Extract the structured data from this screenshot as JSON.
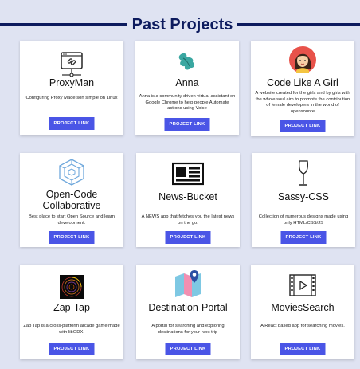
{
  "header": {
    "title": "Past Projects"
  },
  "projects": [
    {
      "name": "ProxyMan",
      "desc": "Configuring Proxy Made son simple on Linux",
      "button": "PROJECT LINK",
      "icon": "network-link-icon"
    },
    {
      "name": "Anna",
      "desc": "Anna is a community driven virtual assistant on Google Chrome to help people Automate actions using Voice",
      "button": "PROJECT LINK",
      "icon": "leaf-logo-icon"
    },
    {
      "name": "Code Like A Girl",
      "desc": "A website created for the girls and by girls with the whole soul aim to promote the contribution of female developers in the world of opensource",
      "button": "PROJECT LINK",
      "icon": "girl-avatar-icon"
    },
    {
      "name": "Open-Code Collaborative",
      "desc": "Best place to start Open Source and learn development.",
      "button": "PROJECT LINK",
      "icon": "cube-logo-icon"
    },
    {
      "name": "News-Bucket",
      "desc": "A NEWS app that fetches you the latest news on the go.",
      "button": "PROJECT LINK",
      "icon": "newspaper-icon"
    },
    {
      "name": "Sassy-CSS",
      "desc": "Collection of numerous designs made using only HTML/CSS/JS",
      "button": "PROJECT LINK",
      "icon": "wine-glass-icon"
    },
    {
      "name": "Zap-Tap",
      "desc": "Zap Tap is a cross-platform arcade game made with libGDX.",
      "button": "PROJECT LINK",
      "icon": "spiral-game-icon"
    },
    {
      "name": "Destination-Portal",
      "desc": "A portal for searching and exploring destinations for your next trip",
      "button": "PROJECT LINK",
      "icon": "map-pin-icon"
    },
    {
      "name": "MoviesSearch",
      "desc": "A React based app for searching movies.",
      "button": "PROJECT LINK",
      "icon": "film-strip-icon"
    }
  ]
}
